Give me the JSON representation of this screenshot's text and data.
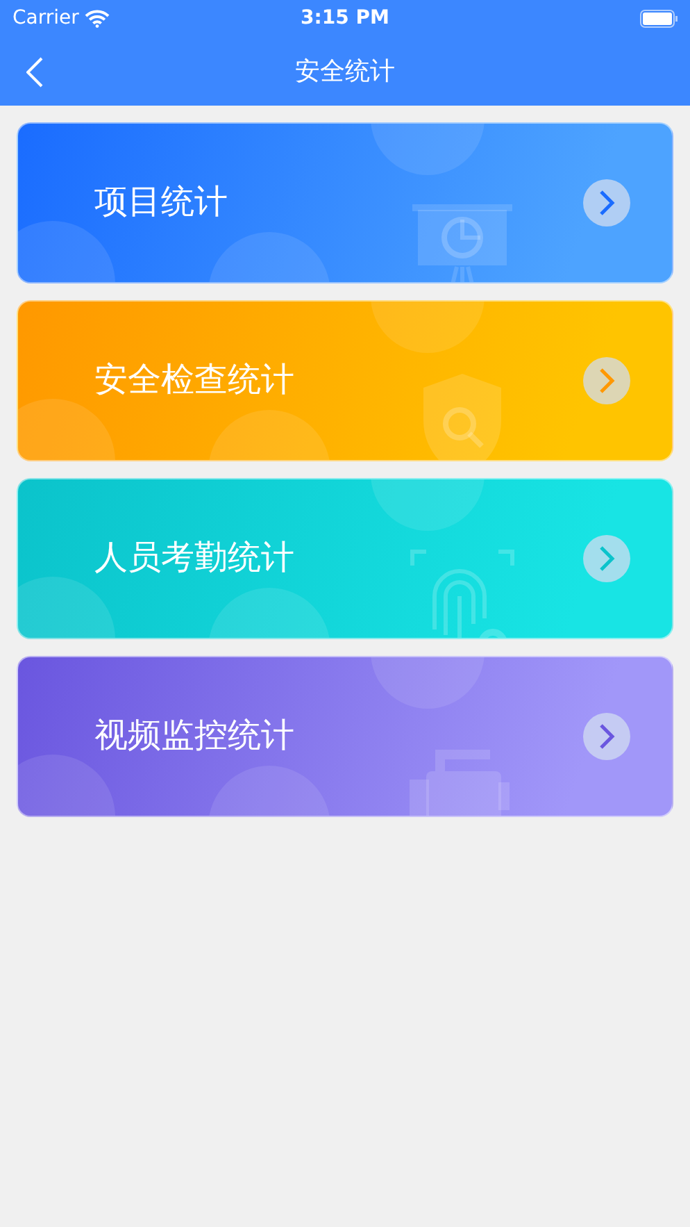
{
  "status_bar": {
    "carrier": "Carrier",
    "time": "3:15 PM"
  },
  "nav_bar": {
    "title": "安全统计"
  },
  "cards": [
    {
      "title": "项目统计",
      "kind": "chart",
      "color": "#1a6cff"
    },
    {
      "title": "安全检查统计",
      "kind": "shield",
      "color": "#ff9800"
    },
    {
      "title": "人员考勤统计",
      "kind": "fingerprint",
      "color": "#0bc3cb"
    },
    {
      "title": "视频监控统计",
      "kind": "camera",
      "color": "#6a56df"
    }
  ]
}
